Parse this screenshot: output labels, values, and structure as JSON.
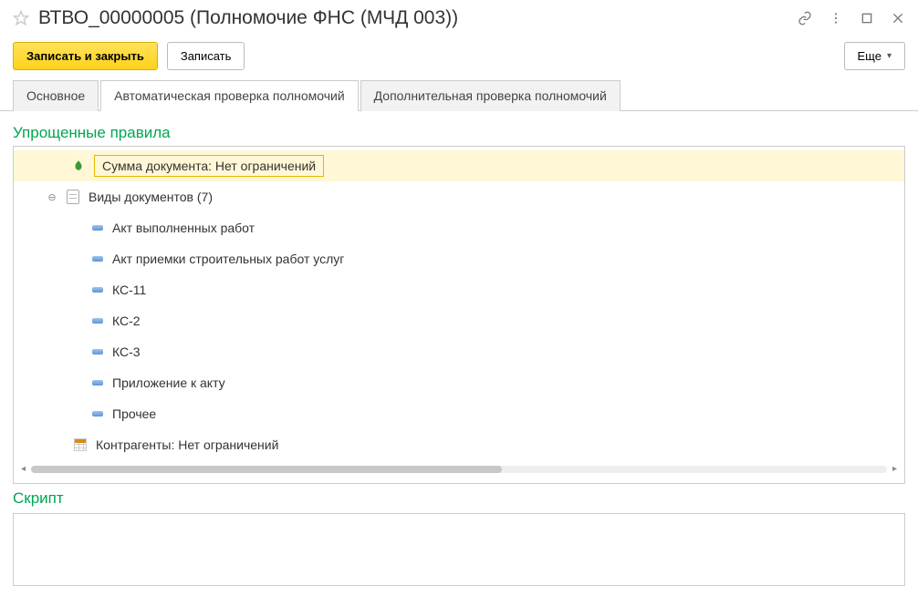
{
  "header": {
    "title": "ВТВО_00000005 (Полномочие ФНС (МЧД 003))"
  },
  "toolbar": {
    "save_close": "Записать и закрыть",
    "save": "Записать",
    "more": "Еще"
  },
  "tabs": {
    "t1": "Основное",
    "t2": "Автоматическая проверка полномочий",
    "t3": "Дополнительная проверка полномочий"
  },
  "sections": {
    "rules_title": "Упрощенные правила",
    "script_title": "Скрипт"
  },
  "tree": {
    "sum_doc": "Сумма документа: Нет ограничений",
    "doc_types": "Виды документов (7)",
    "children": [
      "Акт выполненных работ",
      "Акт приемки строительных работ услуг",
      "КС-11",
      "КС-2",
      "КС-3",
      "Приложение к акту",
      "Прочее"
    ],
    "counterparties": "Контрагенты: Нет ограничений"
  }
}
